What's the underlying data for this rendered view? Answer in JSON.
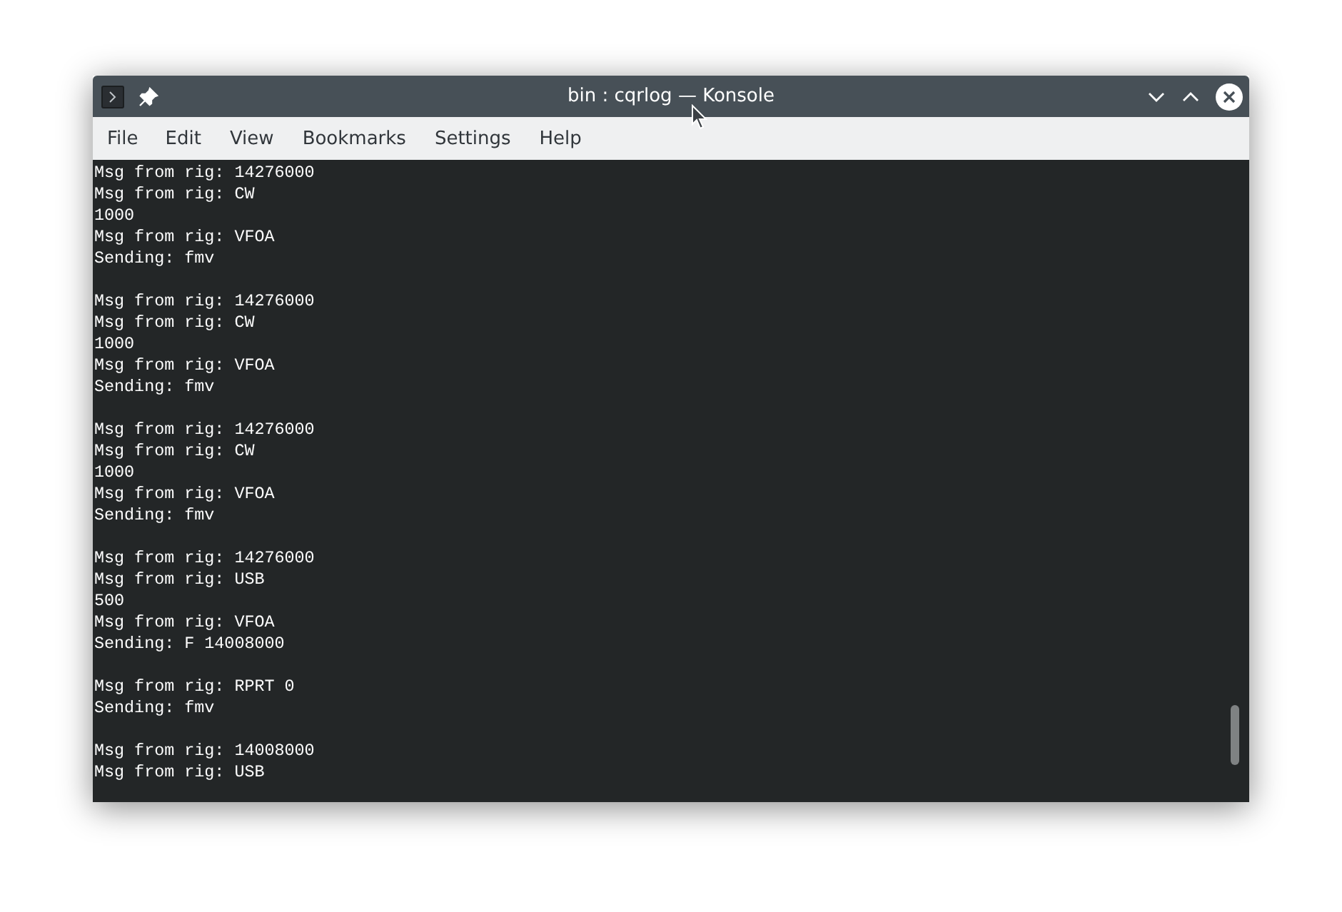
{
  "window": {
    "title": "bin : cqrlog — Konsole"
  },
  "menu": [
    "File",
    "Edit",
    "View",
    "Bookmarks",
    "Settings",
    "Help"
  ],
  "terminal": {
    "blocks": [
      [
        "Msg from rig: 14276000",
        "Msg from rig: CW",
        "1000",
        "Msg from rig: VFOA",
        "Sending: fmv"
      ],
      [
        "Msg from rig: 14276000",
        "Msg from rig: CW",
        "1000",
        "Msg from rig: VFOA",
        "Sending: fmv"
      ],
      [
        "Msg from rig: 14276000",
        "Msg from rig: CW",
        "1000",
        "Msg from rig: VFOA",
        "Sending: fmv"
      ],
      [
        "Msg from rig: 14276000",
        "Msg from rig: USB",
        "500",
        "Msg from rig: VFOA",
        "Sending: F 14008000"
      ],
      [
        "Msg from rig: RPRT 0",
        "Sending: fmv"
      ],
      [
        "Msg from rig: 14008000",
        "Msg from rig: USB"
      ]
    ]
  }
}
